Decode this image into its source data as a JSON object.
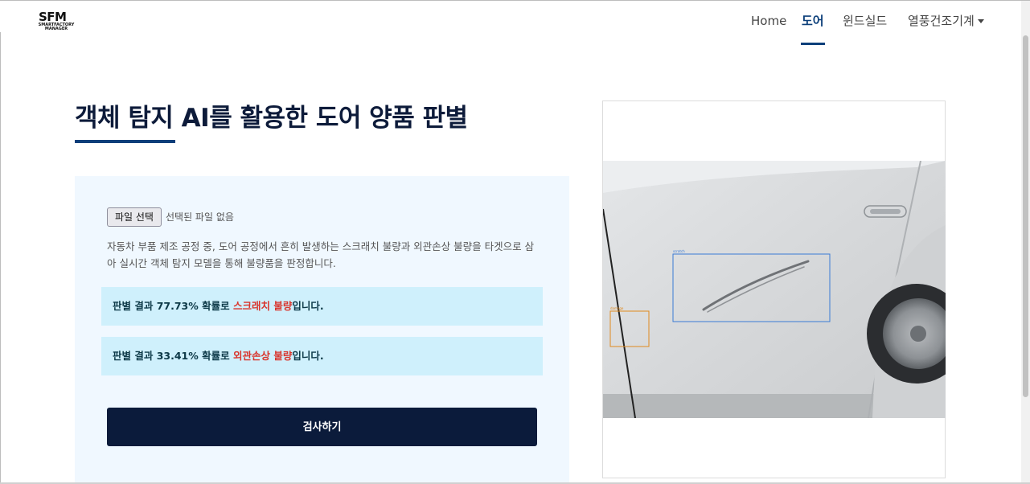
{
  "brand": {
    "logo_main": "SFM",
    "logo_sub_1": "SMARTFACTORY",
    "logo_sub_2": "MANAGER"
  },
  "nav": {
    "items": [
      {
        "label": "Home"
      },
      {
        "label": "도어"
      },
      {
        "label": "윈드실드"
      },
      {
        "label": "열풍건조기계"
      }
    ],
    "active": "도어"
  },
  "page": {
    "title": "객체 탐지 AI를 활용한 도어 양품 판별"
  },
  "upload": {
    "button_label": "파일 선택",
    "status": "선택된 파일 없음"
  },
  "description": "자동차 부품 제조 공정 중, 도어 공정에서 흔히 발생하는 스크래치 불량과 외관손상 불량을 타겟으로 삼아 실시간 객체 탐지 모델을 통해 불량품을 판정합니다.",
  "results": [
    {
      "prefix": "판별 결과 ",
      "probability": "77.73%",
      "middle": " 확률로 ",
      "defect": "스크래치 불량",
      "suffix": "입니다."
    },
    {
      "prefix": "판별 결과 ",
      "probability": "33.41%",
      "middle": " 확률로 ",
      "defect": "외관손상 불량",
      "suffix": "입니다."
    }
  ],
  "actions": {
    "inspect_label": "검사하기"
  },
  "detections": [
    {
      "label": "scratch",
      "color": "#3a7bd5"
    },
    {
      "label": "damage",
      "color": "#e08a1e"
    }
  ],
  "colors": {
    "primary": "#0c3f7a",
    "dark_button": "#0b1b3b",
    "result_bg": "#cff0fc",
    "defect_red": "#d9342b",
    "panel_bg": "#f0f8ff"
  }
}
